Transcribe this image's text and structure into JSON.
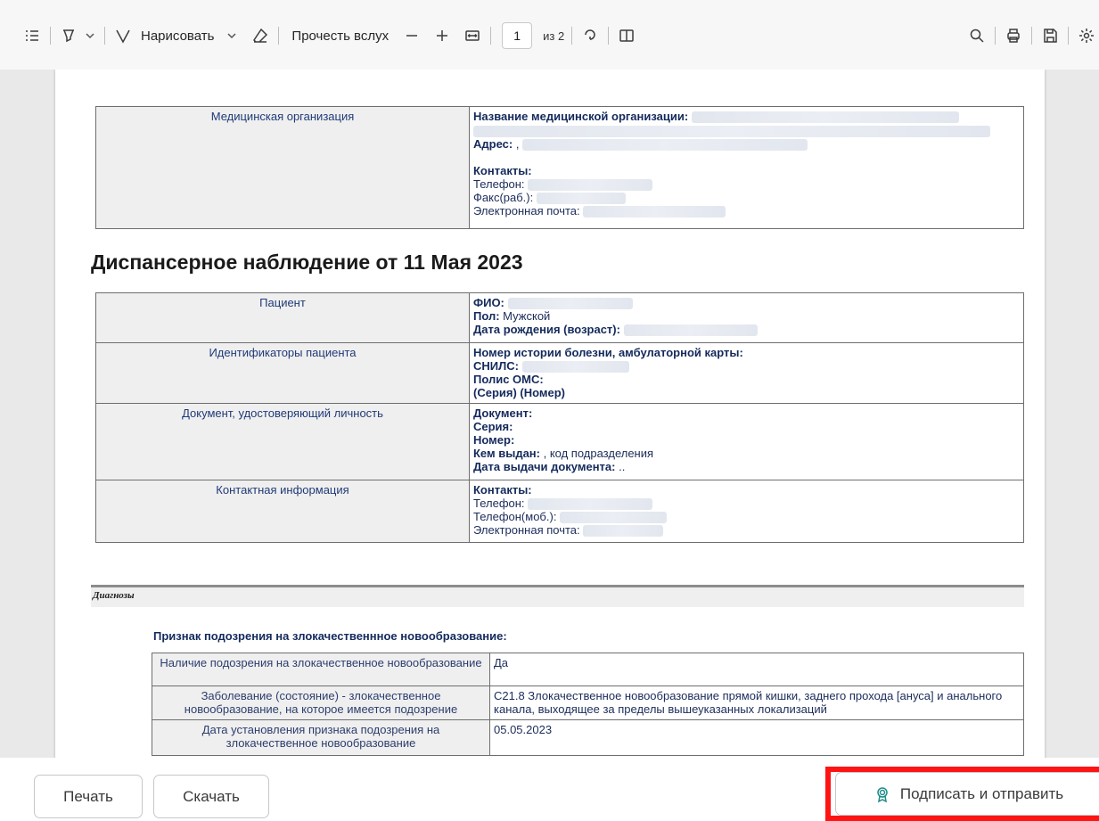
{
  "toolbar": {
    "draw_label": "Нарисовать",
    "read_aloud_label": "Прочесть вслух",
    "page_current": "1",
    "page_total": "из 2"
  },
  "org_table": {
    "label": "Медицинская организация",
    "name_label": "Название медицинской организации:",
    "address_label": "Адрес:",
    "address_value": " ,",
    "contacts_label": "Контакты:",
    "phone_label": "Телефон:",
    "fax_label": "Факс(раб.):",
    "email_label": "Электронная почта:"
  },
  "heading": "Диспансерное наблюдение от 11 Мая 2023",
  "patient_table": {
    "patient_label": "Пациент",
    "fio_label": "ФИО:",
    "sex_label": "Пол:",
    "sex_value": " Мужской",
    "dob_label": "Дата рождения (возраст):",
    "ids_label": "Идентификаторы пациента",
    "card_label": "Номер истории болезни, амбулаторной карты:",
    "snils_label": "СНИЛС:",
    "oms_label": "Полис ОМС:",
    "oms_series": "(Серия) (Номер)",
    "doc_label": "Документ, удостоверяющий личность",
    "document_label": "Документ:",
    "series_label": "Серия:",
    "number_label": "Номер:",
    "issued_by_label": "Кем выдан:",
    "issued_by_value": " , код подразделения",
    "issue_date_label": "Дата выдачи документа:",
    "issue_date_value": " ..",
    "contact_info_label": "Контактная информация",
    "contacts_label": "Контакты:",
    "phone_label": "Телефон:",
    "mobile_label": "Телефон(моб.):",
    "email_label": "Электронная почта:"
  },
  "diagnoses": {
    "section_label": "Диагнозы",
    "suspicion_title": "Признак подозрения на злокачественнное новообразование:",
    "rows": [
      {
        "label": "Наличие подозрения на злокачественное новообразование",
        "value": "Да"
      },
      {
        "label": "Заболевание (состояние) - злокачественное новообразование, на которое имеется подозрение",
        "value": "С21.8 Злокачественное новообразование прямой кишки, заднего прохода [ануса] и анального канала, выходящее за пределы вышеуказанных локализаций"
      },
      {
        "label": "Дата установления признака подозрения на злокачественное новообразование",
        "value": "05.05.2023"
      }
    ]
  },
  "footer": {
    "print_label": "Печать",
    "download_label": "Скачать",
    "sign_label": "Подписать и отправить"
  },
  "colors": {
    "highlight": "#ff1414",
    "text_navy": "#142a5c",
    "label_bg": "#efefef",
    "sign_icon": "#1c8c88"
  }
}
